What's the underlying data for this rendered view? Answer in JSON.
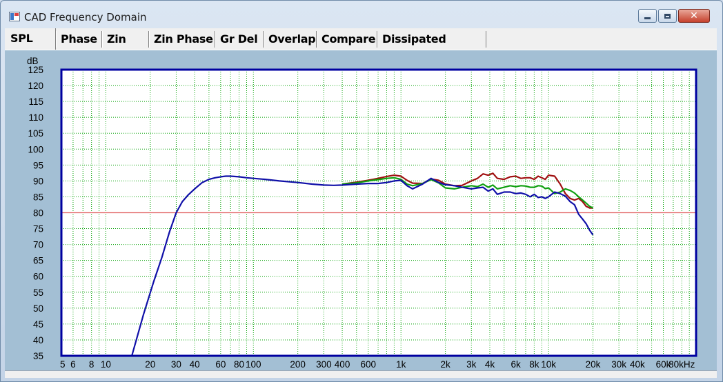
{
  "window": {
    "title": "CAD Frequency Domain",
    "min_icon": "minimize-icon",
    "max_icon": "maximize-icon",
    "close_icon": "close-icon"
  },
  "tabs": [
    {
      "label": "SPL",
      "active": true
    },
    {
      "label": "Phase",
      "active": false
    },
    {
      "label": "Zin",
      "active": false
    },
    {
      "label": "Zin Phase",
      "active": false
    },
    {
      "label": "Gr Del",
      "active": false
    },
    {
      "label": "Overlap",
      "active": false
    },
    {
      "label": "Compare",
      "active": false
    },
    {
      "label": "Dissipated Power",
      "active": false
    }
  ],
  "chart_data": {
    "type": "line",
    "ylabel": "dB",
    "xlabel": "",
    "xscale": "log",
    "xlim": [
      5,
      100000
    ],
    "ylim": [
      35,
      125
    ],
    "yticks": [
      35,
      40,
      45,
      50,
      55,
      60,
      65,
      70,
      75,
      80,
      85,
      90,
      95,
      100,
      105,
      110,
      115,
      120,
      125
    ],
    "xtick_labels": [
      {
        "v": 5,
        "t": "5"
      },
      {
        "v": 6,
        "t": "6"
      },
      {
        "v": 8,
        "t": "8"
      },
      {
        "v": 10,
        "t": "10"
      },
      {
        "v": 20,
        "t": "20"
      },
      {
        "v": 30,
        "t": "30"
      },
      {
        "v": 40,
        "t": "40"
      },
      {
        "v": 60,
        "t": "60"
      },
      {
        "v": 80,
        "t": "80"
      },
      {
        "v": 100,
        "t": "100"
      },
      {
        "v": 200,
        "t": "200"
      },
      {
        "v": 300,
        "t": "300"
      },
      {
        "v": 400,
        "t": "400"
      },
      {
        "v": 600,
        "t": "600"
      },
      {
        "v": 1000,
        "t": "1k"
      },
      {
        "v": 2000,
        "t": "2k"
      },
      {
        "v": 3000,
        "t": "3k"
      },
      {
        "v": 4000,
        "t": "4k"
      },
      {
        "v": 6000,
        "t": "6k"
      },
      {
        "v": 8000,
        "t": "8k"
      },
      {
        "v": 10000,
        "t": "10k"
      },
      {
        "v": 20000,
        "t": "20k"
      },
      {
        "v": 30000,
        "t": "30k"
      },
      {
        "v": 40000,
        "t": "40k"
      },
      {
        "v": 60000,
        "t": "60k"
      },
      {
        "v": 80000,
        "t": "80kHz"
      }
    ],
    "grid": true,
    "colors": {
      "background": "#ffffff",
      "frame": "#0000a0",
      "grid": "#00a000",
      "reference": "#e06060"
    },
    "reference_line": 80,
    "series": [
      {
        "color": "#a01010",
        "x": [
          400,
          500,
          600,
          700,
          800,
          900,
          1000,
          1100,
          1200,
          1400,
          1600,
          1800,
          2000,
          2300,
          2600,
          3000,
          3300,
          3600,
          3900,
          4200,
          4500,
          5000,
          5500,
          6000,
          6500,
          7000,
          7500,
          8000,
          8500,
          9000,
          9500,
          10000,
          11000,
          12000,
          13000,
          14000,
          15000,
          16000,
          17000,
          18000,
          19000,
          20000
        ],
        "y": [
          89,
          89.6,
          90.2,
          90.8,
          91.4,
          91.8,
          91.5,
          90.2,
          89.3,
          89.2,
          90.6,
          90.2,
          89.0,
          88.5,
          88.6,
          90.0,
          90.8,
          92.2,
          91.8,
          92.4,
          90.8,
          90.5,
          91.3,
          91.5,
          90.8,
          91.0,
          91.0,
          90.5,
          91.5,
          91.0,
          90.5,
          91.8,
          91.5,
          89.0,
          86.0,
          84.5,
          84.0,
          84.5,
          83.5,
          82.0,
          81.5,
          81.5
        ]
      },
      {
        "color": "#10a010",
        "x": [
          400,
          500,
          600,
          700,
          800,
          900,
          1000,
          1100,
          1200,
          1400,
          1600,
          1800,
          2000,
          2300,
          2600,
          3000,
          3300,
          3600,
          3900,
          4200,
          4500,
          5000,
          5500,
          6000,
          6500,
          7000,
          7500,
          8000,
          8500,
          9000,
          9500,
          10000,
          11000,
          12000,
          13000,
          14000,
          15000,
          16000,
          17000,
          18000,
          19000,
          20000
        ],
        "y": [
          89,
          89.4,
          90.0,
          90.4,
          90.8,
          91.0,
          90.5,
          89.0,
          88.5,
          89.2,
          90.4,
          89.4,
          87.8,
          87.5,
          88.0,
          88.5,
          88.2,
          89.0,
          88.0,
          88.7,
          87.5,
          88.0,
          88.5,
          88.2,
          88.5,
          88.4,
          88.0,
          88.0,
          88.5,
          88.4,
          87.6,
          87.8,
          86.0,
          86.5,
          87.5,
          87.0,
          86.2,
          85.0,
          84.0,
          83.0,
          82.0,
          81.5
        ]
      },
      {
        "color": "#1010a8",
        "x": [
          15,
          18,
          21,
          24,
          27,
          30,
          33,
          36,
          40,
          45,
          50,
          55,
          60,
          65,
          70,
          80,
          90,
          100,
          120,
          150,
          200,
          250,
          300,
          350,
          400,
          500,
          600,
          700,
          800,
          900,
          1000,
          1100,
          1200,
          1400,
          1600,
          1800,
          2000,
          2300,
          2600,
          3000,
          3300,
          3600,
          3900,
          4200,
          4500,
          5000,
          5500,
          6000,
          6500,
          7000,
          7500,
          8000,
          8500,
          9000,
          9500,
          10000,
          11000,
          12000,
          13000,
          14000,
          15000,
          16000,
          17000,
          18000,
          19000,
          20000
        ],
        "y": [
          35,
          48,
          58,
          66,
          74,
          80,
          83.5,
          85.5,
          87.5,
          89.5,
          90.5,
          91.0,
          91.3,
          91.5,
          91.5,
          91.3,
          91.0,
          90.8,
          90.5,
          90.0,
          89.5,
          89.0,
          88.7,
          88.6,
          88.7,
          89.0,
          89.2,
          89.2,
          89.5,
          90.0,
          90.2,
          88.5,
          87.5,
          89.0,
          90.8,
          89.5,
          88.8,
          88.5,
          88.0,
          87.5,
          87.8,
          88.0,
          86.8,
          87.5,
          85.8,
          86.5,
          86.5,
          86.0,
          86.2,
          85.8,
          85.0,
          85.8,
          84.8,
          85.0,
          84.5,
          85.0,
          86.5,
          86.0,
          85.2,
          83.5,
          82.5,
          79.5,
          78.0,
          76.5,
          74.5,
          73.0
        ]
      }
    ]
  }
}
